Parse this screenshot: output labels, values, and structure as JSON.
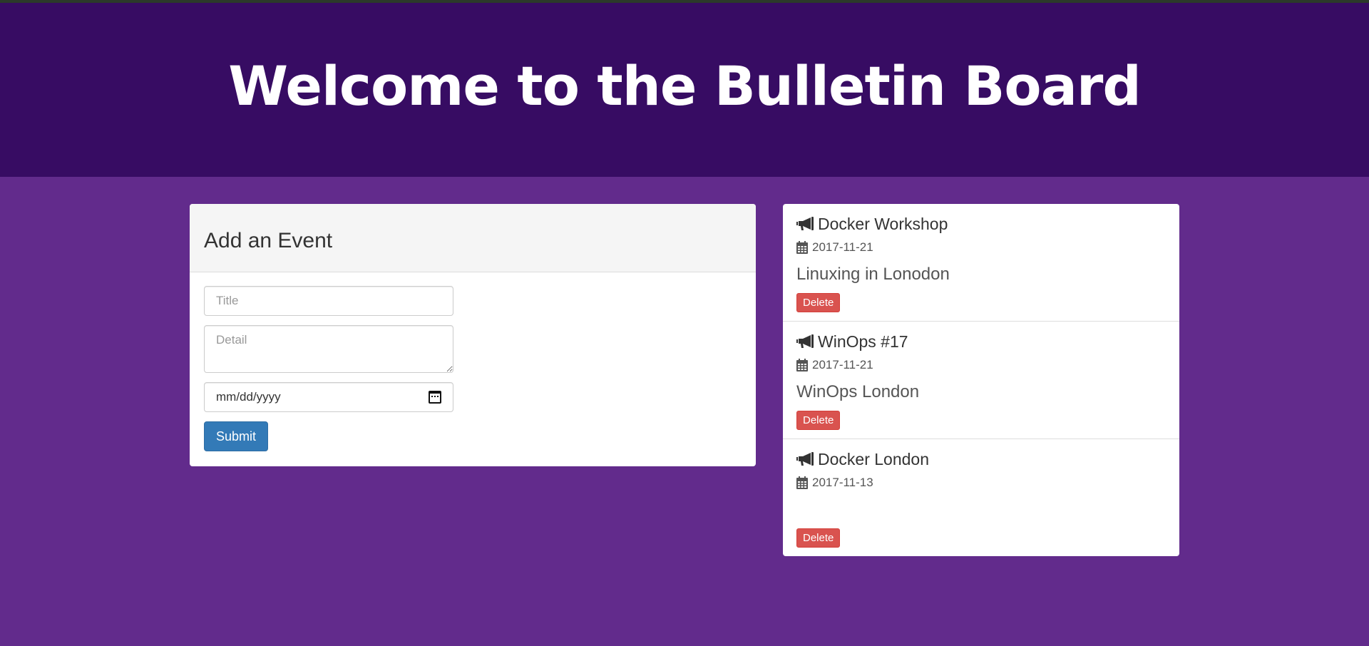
{
  "colors": {
    "hero_bg": "#370c63",
    "page_bg": "#622b8c",
    "primary_button": "#337ab7",
    "danger_button": "#d9534f"
  },
  "hero": {
    "title": "Welcome to the Bulletin Board"
  },
  "add_event": {
    "heading": "Add an Event",
    "title_placeholder": "Title",
    "detail_placeholder": "Detail",
    "date_placeholder": "mm/dd/yyyy",
    "submit_label": "Submit"
  },
  "events": [
    {
      "icon": "bullhorn-icon",
      "title": "Docker Workshop",
      "date": "2017-11-21",
      "detail": "Linuxing in Lonodon",
      "delete_label": "Delete"
    },
    {
      "icon": "bullhorn-icon",
      "title": "WinOps #17",
      "date": "2017-11-21",
      "detail": "WinOps London",
      "delete_label": "Delete"
    },
    {
      "icon": "bullhorn-icon",
      "title": "Docker London",
      "date": "2017-11-13",
      "detail": "",
      "delete_label": "Delete"
    }
  ]
}
